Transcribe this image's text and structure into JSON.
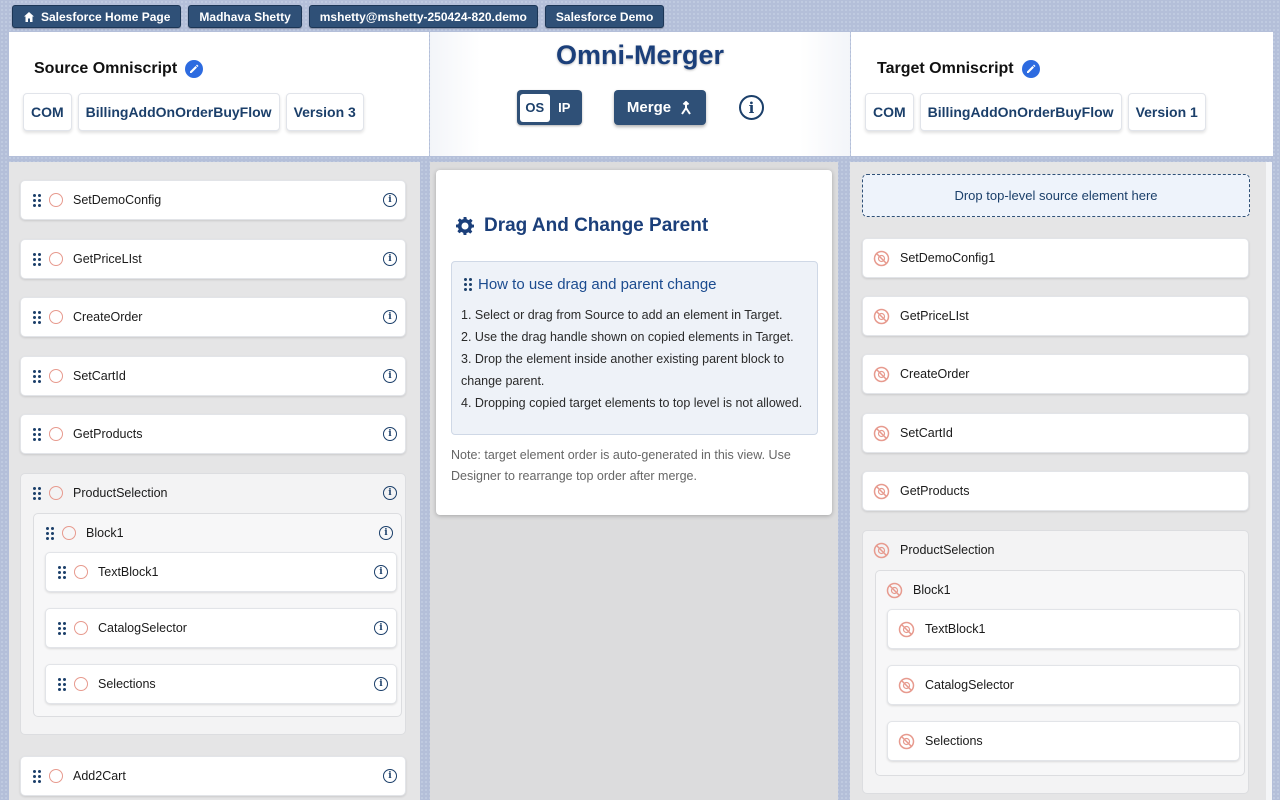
{
  "nav": {
    "home": "Salesforce Home Page",
    "user": "Madhava Shetty",
    "username": "mshetty@mshetty-250424-820.demo",
    "org": "Salesforce Demo"
  },
  "source": {
    "title": "Source Omniscript",
    "type": "COM",
    "subtype": "BillingAddOnOrderBuyFlow",
    "version": "Version 3"
  },
  "target": {
    "title": "Target Omniscript",
    "type": "COM",
    "subtype": "BillingAddOnOrderBuyFlow",
    "version": "Version 1"
  },
  "center": {
    "app_title": "Omni-Merger",
    "toggle_on": "OS",
    "toggle_off": "IP",
    "merge_label": "Merge",
    "info_glyph": "i"
  },
  "guide": {
    "title": "Drag And Change Parent",
    "howto_title": "How to use drag and parent change",
    "steps": [
      "1. Select or drag from Source to add an element in Target.",
      "2. Use the drag handle shown on copied elements in Target.",
      "3. Drop the element inside another existing parent block to change parent.",
      "4. Dropping copied target elements to top level is not allowed."
    ],
    "note": "Note: target element order is auto-generated in this view. Use Designer to rearrange top order after merge."
  },
  "source_elements": {
    "setdemoconfig": "SetDemoConfig",
    "getpricelist": "GetPriceLIst",
    "createorder": "CreateOrder",
    "setcartid": "SetCartId",
    "getproducts": "GetProducts",
    "productselection": "ProductSelection",
    "block1": "Block1",
    "textblock1": "TextBlock1",
    "catalogselector": "CatalogSelector",
    "selections": "Selections",
    "add2cart": "Add2Cart"
  },
  "target_elements": {
    "dropzone": "Drop top-level source element here",
    "setdemoconfig1": "SetDemoConfig1",
    "getpricelist": "GetPriceLIst",
    "createorder": "CreateOrder",
    "setcartid": "SetCartId",
    "getproducts": "GetProducts",
    "productselection": "ProductSelection",
    "block1": "Block1",
    "textblock1": "TextBlock1",
    "catalogselector": "CatalogSelector",
    "selections": "Selections"
  },
  "icons": {
    "element_status_source": "empty-circle-icon",
    "element_status_target": "no-entry-icon",
    "accent": "#2f5077",
    "title_color": "#1b3f7a"
  }
}
